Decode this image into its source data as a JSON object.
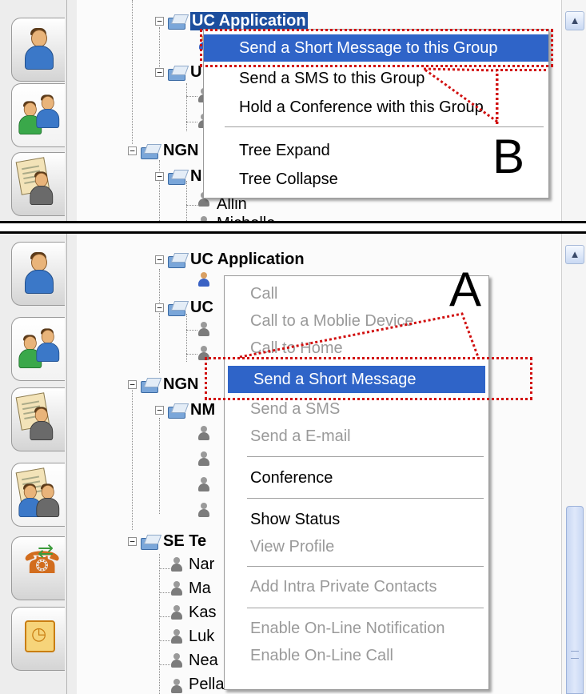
{
  "top_panel": {
    "tree": {
      "uc_application": "UC Application",
      "uc_second_partial": "U",
      "ngn_partial": "NGN",
      "nm_partial": "N",
      "leaf_1": "Allin",
      "leaf_2": "Michelle"
    },
    "context_menu": {
      "items": [
        "Send a Short Message to this Group",
        "Send a SMS to this Group",
        "Hold a Conference with this Group",
        "Tree Expand",
        "Tree Collapse"
      ],
      "highlighted_index": 0
    },
    "callout_label": "B"
  },
  "bottom_panel": {
    "tree": {
      "uc_application": "UC Application",
      "uc_partial": "UC",
      "ngn_partial": "NGN",
      "nm_partial": "NM",
      "se_partial": "SE Te",
      "leaves": [
        "Nar",
        "Ma",
        "Kas",
        "Luk",
        "Nea",
        "Pella"
      ]
    },
    "context_menu": {
      "items": [
        {
          "label": "Call",
          "enabled": false
        },
        {
          "label": "Call to a Moblie Device",
          "enabled": false
        },
        {
          "label": "Call to Home",
          "enabled": false
        },
        {
          "label": "Send a Short Message",
          "enabled": true,
          "highlighted": true
        },
        {
          "label": "Send a SMS",
          "enabled": false
        },
        {
          "label": "Send a E-mail",
          "enabled": false
        },
        {
          "label": "Conference",
          "enabled": true
        },
        {
          "label": "Show Status",
          "enabled": true
        },
        {
          "label": "View Profile",
          "enabled": false
        },
        {
          "label": "Add Intra Private Contacts",
          "enabled": false
        },
        {
          "label": "Enable On-Line Notification",
          "enabled": false
        },
        {
          "label": "Enable On-Line Call",
          "enabled": false
        }
      ]
    },
    "callout_label": "A"
  },
  "side_tabs_top": [
    "contacts-tab-icon",
    "groups-tab-icon",
    "directory-tab-icon"
  ],
  "side_tabs_bottom": [
    "contacts-tab-icon",
    "groups-tab-icon",
    "directory-tab-icon",
    "conference-tab-icon",
    "call-forward-tab-icon",
    "calendar-tab-icon"
  ],
  "colors": {
    "highlight": "#2f64c8",
    "callout": "#d11010",
    "disabled_text": "#9a9a9a"
  },
  "icons": {
    "scroll_up": "▲"
  }
}
